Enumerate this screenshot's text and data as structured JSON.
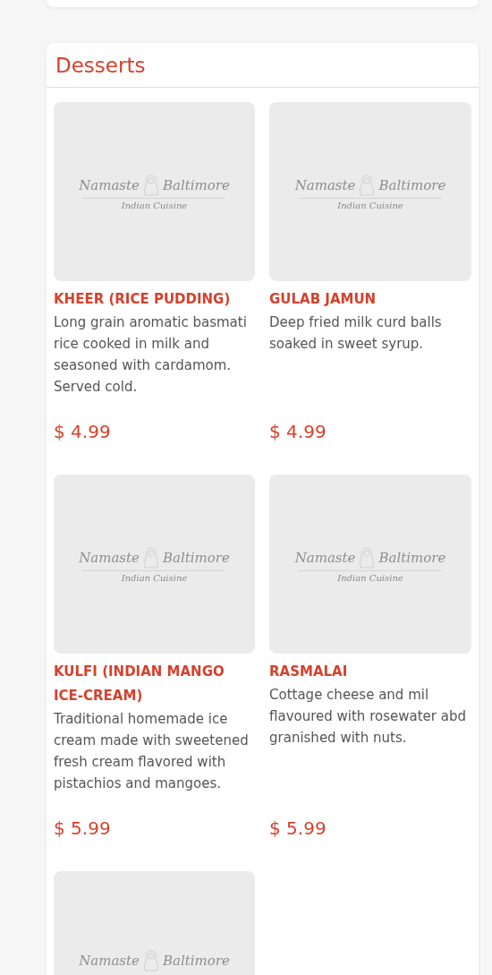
{
  "section": {
    "title": "Desserts",
    "items": [
      {
        "name": "KHEER (RICE PUDDING)",
        "description": "Long grain aromatic basmati rice cooked in milk and seasoned with cardamom. Served cold.",
        "price": "$ 4.99",
        "image": {
          "logo_title": [
            "Namaste",
            "Baltimore"
          ],
          "logo_subtitle": "Indian Cuisine"
        }
      },
      {
        "name": "GULAB JAMUN",
        "description": "Deep fried milk curd balls soaked in sweet syrup.",
        "price": "$ 4.99",
        "image": {
          "logo_title": [
            "Namaste",
            "Baltimore"
          ],
          "logo_subtitle": "Indian Cuisine"
        }
      },
      {
        "name": "KULFI (INDIAN MANGO ICE-CREAM)",
        "description": "Traditional homemade ice cream made with sweetened fresh cream flavored with pistachios and mangoes.",
        "price": "$ 5.99",
        "image": {
          "logo_title": [
            "Namaste",
            "Baltimore"
          ],
          "logo_subtitle": "Indian Cuisine"
        }
      },
      {
        "name": "RASMALAI",
        "description": "Cottage cheese and mil flavoured with rosewater abd granished with nuts.",
        "price": "$ 5.99",
        "image": {
          "logo_title": [
            "Namaste",
            "Baltimore"
          ],
          "logo_subtitle": "Indian Cuisine"
        }
      },
      {
        "image": {
          "logo_title": [
            "Namaste",
            "Baltimore"
          ]
        }
      }
    ]
  }
}
